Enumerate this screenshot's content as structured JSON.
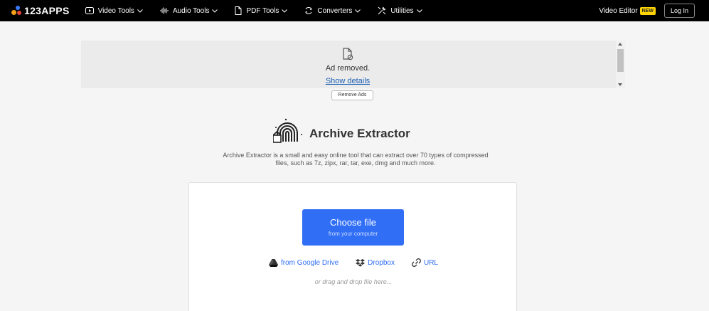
{
  "topbar": {
    "logo_text": "123APPS",
    "nav": [
      {
        "label": "Video Tools",
        "icon": "play-icon"
      },
      {
        "label": "Audio Tools",
        "icon": "audio-wave-icon"
      },
      {
        "label": "PDF Tools",
        "icon": "document-icon"
      },
      {
        "label": "Converters",
        "icon": "convert-icon"
      },
      {
        "label": "Utilities",
        "icon": "tools-icon"
      }
    ],
    "video_editor_label": "Video Editor",
    "new_badge": "NEW",
    "login_label": "Log In"
  },
  "ad": {
    "removed_text": "Ad removed.",
    "show_details": "Show details",
    "remove_ads": "Remove Ads"
  },
  "tool": {
    "title": "Archive Extractor",
    "description_line1": "Archive Extractor is a small and easy online tool that can extract over 70 types of compressed",
    "description_line2": "files, such as 7z, zipx, rar, tar, exe, dmg and much more."
  },
  "upload": {
    "choose_main": "Choose file",
    "choose_sub": "from your computer",
    "google_drive": "from Google Drive",
    "dropbox": "Dropbox",
    "url": "URL",
    "drag_hint": "or drag and drop file here..."
  },
  "colors": {
    "accent": "#2f6ef5",
    "topbar_bg": "#000000",
    "badge": "#ffd400"
  }
}
